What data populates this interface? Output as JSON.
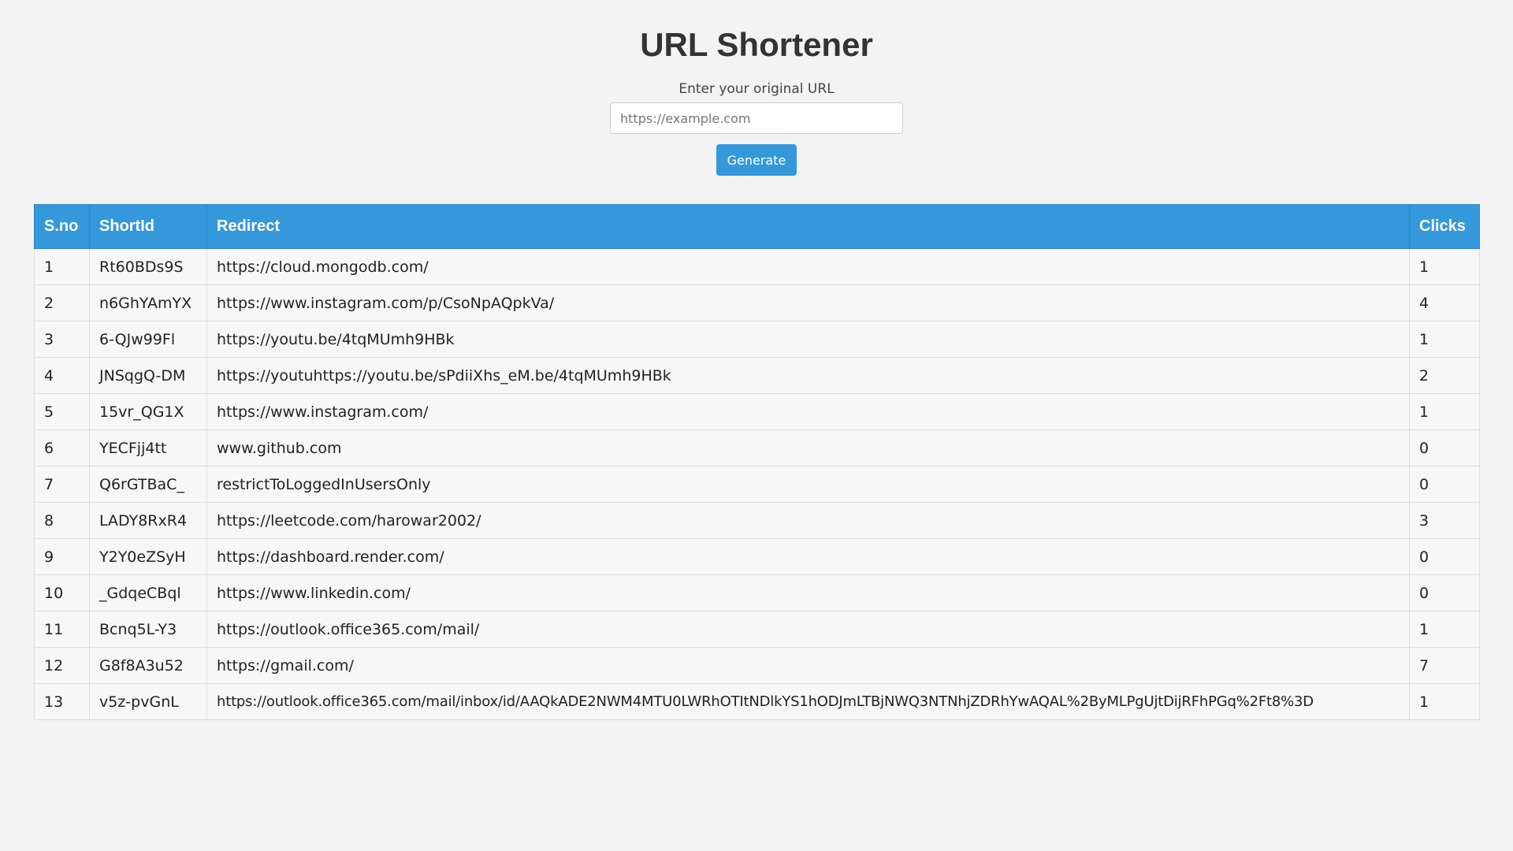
{
  "page": {
    "title": "URL Shortener"
  },
  "form": {
    "label": "Enter your original URL",
    "input_placeholder": "https://example.com",
    "input_value": "",
    "generate_label": "Generate"
  },
  "colors": {
    "accent": "#3498db",
    "background": "#f3f3f3"
  },
  "table": {
    "headers": {
      "sno": "S.no",
      "shortid": "ShortId",
      "redirect": "Redirect",
      "clicks": "Clicks"
    },
    "rows": [
      {
        "sno": "1",
        "shortid": "Rt60BDs9S",
        "redirect": "https://cloud.mongodb.com/",
        "clicks": "1"
      },
      {
        "sno": "2",
        "shortid": "n6GhYAmYX",
        "redirect": "https://www.instagram.com/p/CsoNpAQpkVa/",
        "clicks": "4"
      },
      {
        "sno": "3",
        "shortid": "6-QJw99Fl",
        "redirect": "https://youtu.be/4tqMUmh9HBk",
        "clicks": "1"
      },
      {
        "sno": "4",
        "shortid": "JNSqgQ-DM",
        "redirect": "https://youtuhttps://youtu.be/sPdiiXhs_eM.be/4tqMUmh9HBk",
        "clicks": "2"
      },
      {
        "sno": "5",
        "shortid": "15vr_QG1X",
        "redirect": "https://www.instagram.com/",
        "clicks": "1"
      },
      {
        "sno": "6",
        "shortid": "YECFjj4tt",
        "redirect": "www.github.com",
        "clicks": "0"
      },
      {
        "sno": "7",
        "shortid": "Q6rGTBaC_",
        "redirect": "restrictToLoggedInUsersOnly",
        "clicks": "0"
      },
      {
        "sno": "8",
        "shortid": "LADY8RxR4",
        "redirect": "https://leetcode.com/harowar2002/",
        "clicks": "3"
      },
      {
        "sno": "9",
        "shortid": "Y2Y0eZSyH",
        "redirect": "https://dashboard.render.com/",
        "clicks": "0"
      },
      {
        "sno": "10",
        "shortid": "_GdqeCBql",
        "redirect": "https://www.linkedin.com/",
        "clicks": "0"
      },
      {
        "sno": "11",
        "shortid": "Bcnq5L-Y3",
        "redirect": "https://outlook.office365.com/mail/",
        "clicks": "1"
      },
      {
        "sno": "12",
        "shortid": "G8f8A3u52",
        "redirect": "https://gmail.com/",
        "clicks": "7"
      },
      {
        "sno": "13",
        "shortid": "v5z-pvGnL",
        "redirect": "https://outlook.office365.com/mail/inbox/id/AAQkADE2NWM4MTU0LWRhOTItNDlkYS1hODJmLTBjNWQ3NTNhjZDRhYwAQAL%2ByMLPgUjtDijRFhPGq%2Ft8%3D",
        "clicks": "1"
      }
    ]
  }
}
